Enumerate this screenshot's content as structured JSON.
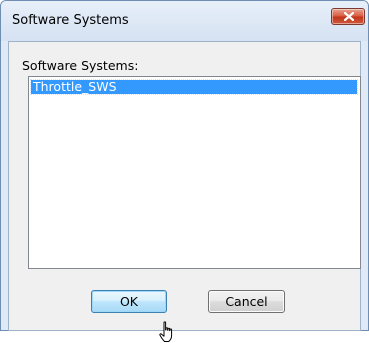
{
  "window": {
    "title": "Software Systems"
  },
  "list": {
    "label": "Software Systems:",
    "items": [
      "Throttle_SWS"
    ],
    "selected_index": 0
  },
  "buttons": {
    "ok_label": "OK",
    "cancel_label": "Cancel"
  },
  "icons": {
    "close": "close-icon",
    "cursor": "hand-pointer-cursor"
  },
  "colors": {
    "selection": "#3399ff",
    "close_button": "#c9462b",
    "ok_border": "#3c7fb1"
  }
}
